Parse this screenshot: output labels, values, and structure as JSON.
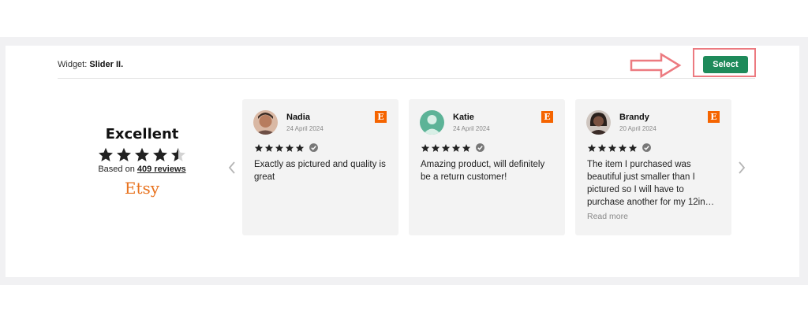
{
  "header": {
    "widget_prefix": "Widget: ",
    "widget_name": "Slider II.",
    "select_label": "Select"
  },
  "summary": {
    "rating_word": "Excellent",
    "stars": 4.5,
    "based_prefix": "Based on ",
    "reviews_link": "409 reviews",
    "platform": "Etsy"
  },
  "reviews": [
    {
      "name": "Nadia",
      "date": "24 April 2024",
      "stars": 5,
      "text": "Exactly as pictured and quality is great",
      "read_more": ""
    },
    {
      "name": "Katie",
      "date": "24 April 2024",
      "stars": 5,
      "text": "Amazing product, will definitely be a return customer!",
      "read_more": ""
    },
    {
      "name": "Brandy",
      "date": "20 April 2024",
      "stars": 5,
      "text": "The item I purchased was beautiful just smaller than I pictured so I will have to purchase another for my 12in…",
      "read_more": "Read more"
    }
  ],
  "colors": {
    "select_button": "#1e8a5a",
    "highlight": "#ec7a80",
    "etsy": "#f56400"
  }
}
